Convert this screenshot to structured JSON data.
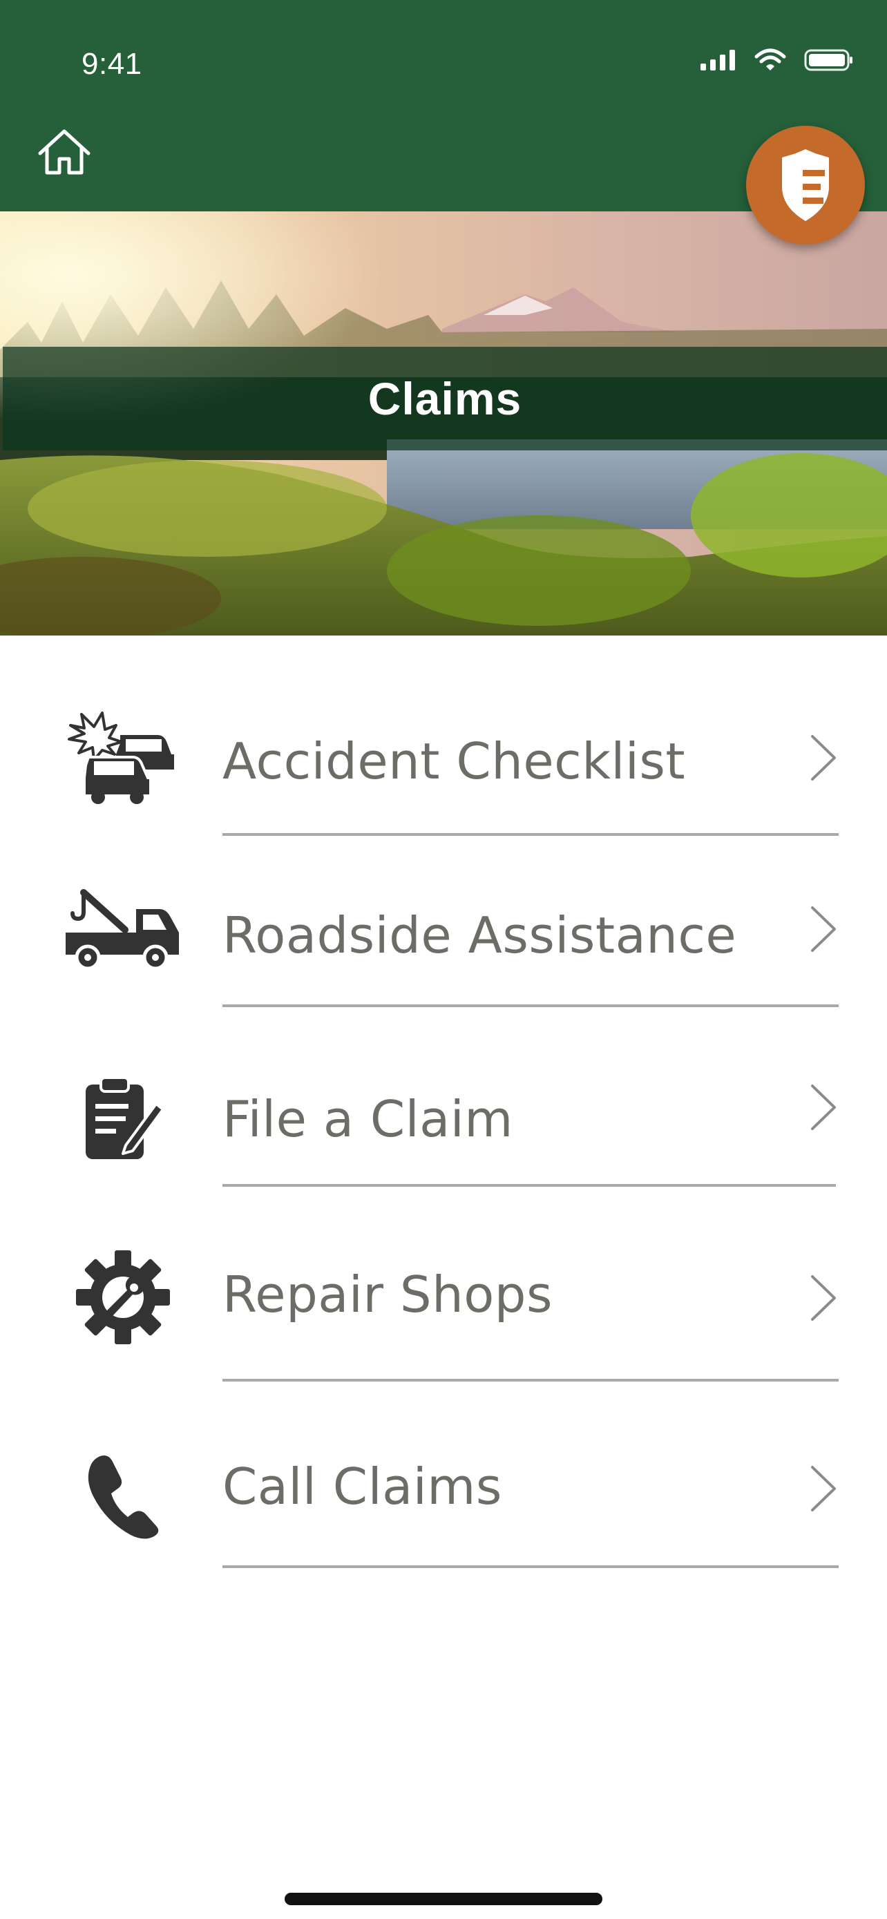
{
  "status_bar": {
    "time": "9:41"
  },
  "hero": {
    "title": "Claims"
  },
  "menu": {
    "items": [
      {
        "label": "Accident Checklist",
        "icon": "car-accident-icon"
      },
      {
        "label": "Roadside Assistance",
        "icon": "tow-truck-icon"
      },
      {
        "label": "File a Claim",
        "icon": "clipboard-pen-icon"
      },
      {
        "label": "Repair Shops",
        "icon": "gear-wrench-icon"
      },
      {
        "label": "Call Claims",
        "icon": "phone-icon"
      }
    ]
  },
  "colors": {
    "header_green": "#25603a",
    "badge_orange": "#c46a2b",
    "label_gray": "#6d6c66",
    "icon_dark": "#333333"
  }
}
